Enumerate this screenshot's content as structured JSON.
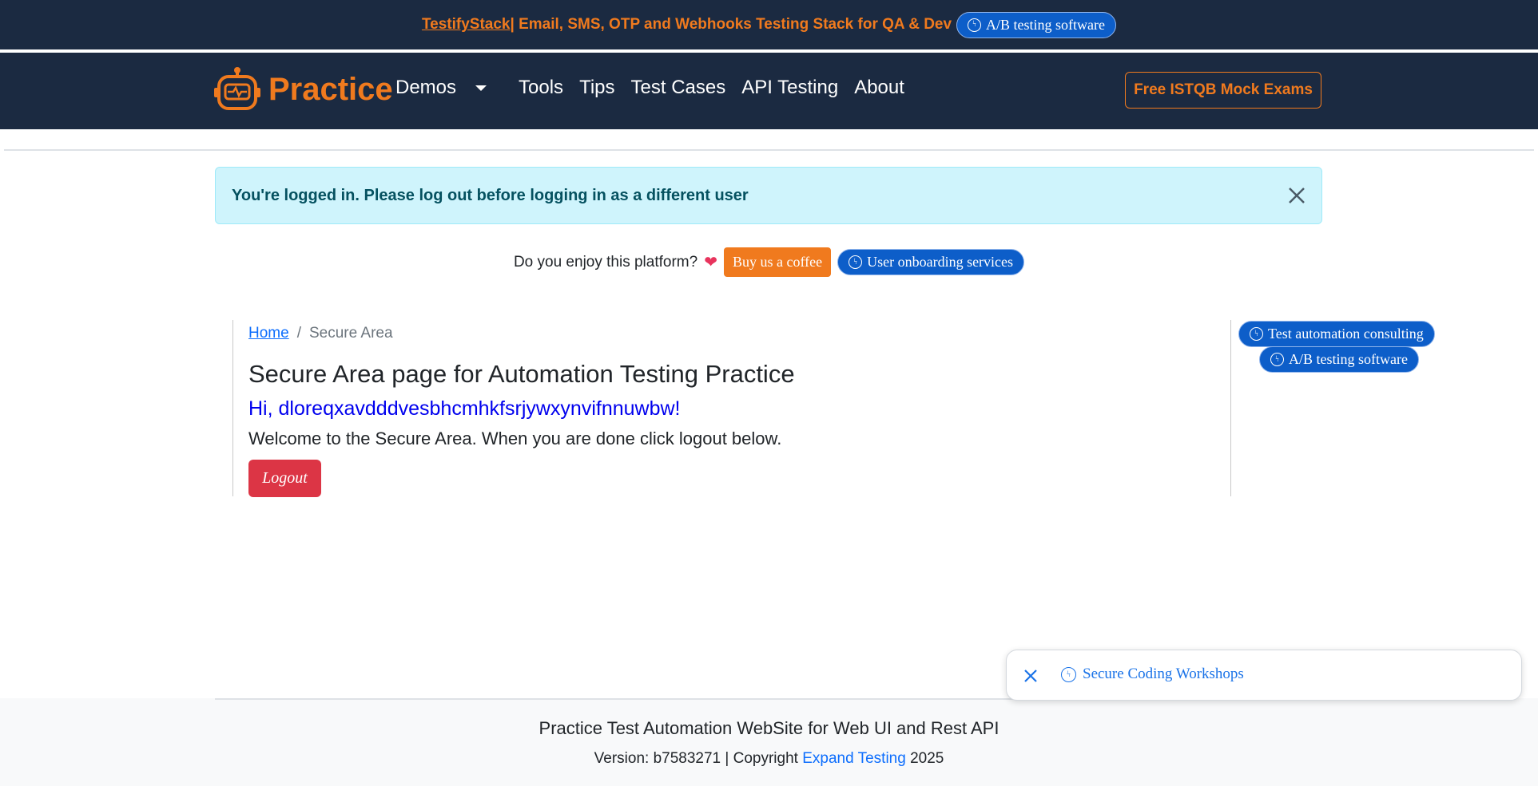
{
  "top_banner": {
    "link_text": "TestifyStack",
    "text": " | Email, SMS, OTP and Webhooks Testing Stack for QA & Dev",
    "ad_label": "A/B testing software"
  },
  "navbar": {
    "brand": "Practice",
    "links": [
      "Demos",
      "Tools",
      "Tips",
      "Test Cases",
      "API Testing",
      "About"
    ],
    "cta": "Free ISTQB Mock Exams"
  },
  "alert": {
    "message": "You're logged in. Please log out before logging in as a different user"
  },
  "enjoy": {
    "text": "Do you enjoy this platform?",
    "heart": "❤",
    "coffee_label": "Buy us a coffee",
    "ad_label": "User onboarding services"
  },
  "breadcrumb": {
    "home": "Home",
    "separator": "/",
    "current": "Secure Area"
  },
  "main": {
    "title": "Secure Area page for Automation Testing Practice",
    "greeting": "Hi, dloreqxavdddvesbhcmhkfsrjywxynvifnnuwbw!",
    "welcome": "Welcome to the Secure Area. When you are done click logout below.",
    "logout_label": "Logout"
  },
  "sidebar": {
    "ad1": "Test automation consulting",
    "ad2": "A/B testing software"
  },
  "toast": {
    "label": "Secure Coding Workshops"
  },
  "footer": {
    "title": "Practice Test Automation WebSite for Web UI and Rest API",
    "version_prefix": "Version: b7583271 | Copyright ",
    "link": "Expand Testing",
    "year": " 2025"
  }
}
